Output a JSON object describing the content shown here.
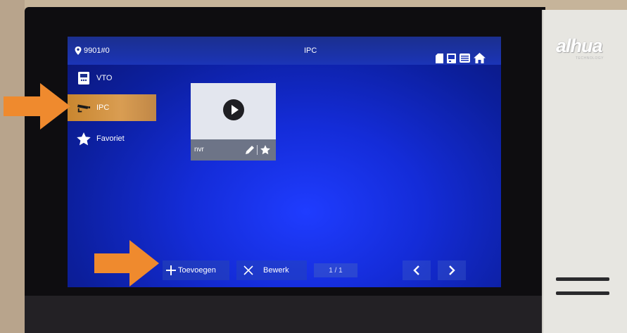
{
  "device": {
    "brand": "alhua",
    "brand_sub": "TECHNOLOGY"
  },
  "screen": {
    "location": "9901#0",
    "title": "IPC",
    "status_icons": [
      "sd-card-icon",
      "monitor-icon",
      "message-icon",
      "home-icon"
    ]
  },
  "sidebar": {
    "items": [
      {
        "label": "VTO",
        "icon": "door-station-icon",
        "active": false
      },
      {
        "label": "IPC",
        "icon": "camera-icon",
        "active": true
      },
      {
        "label": "Favoriet",
        "icon": "star-icon",
        "active": false
      }
    ]
  },
  "tiles": [
    {
      "name": "nvr",
      "icons": [
        "play-icon",
        "pencil-icon",
        "star-icon"
      ]
    }
  ],
  "bottom_bar": {
    "add_label": "Toevoegen",
    "edit_label": "Bewerk",
    "page": "1 / 1"
  },
  "colors": {
    "accent_active": "#d99d52",
    "arrow": "#ef8a2e",
    "screen_blue": "#1f3cff"
  }
}
